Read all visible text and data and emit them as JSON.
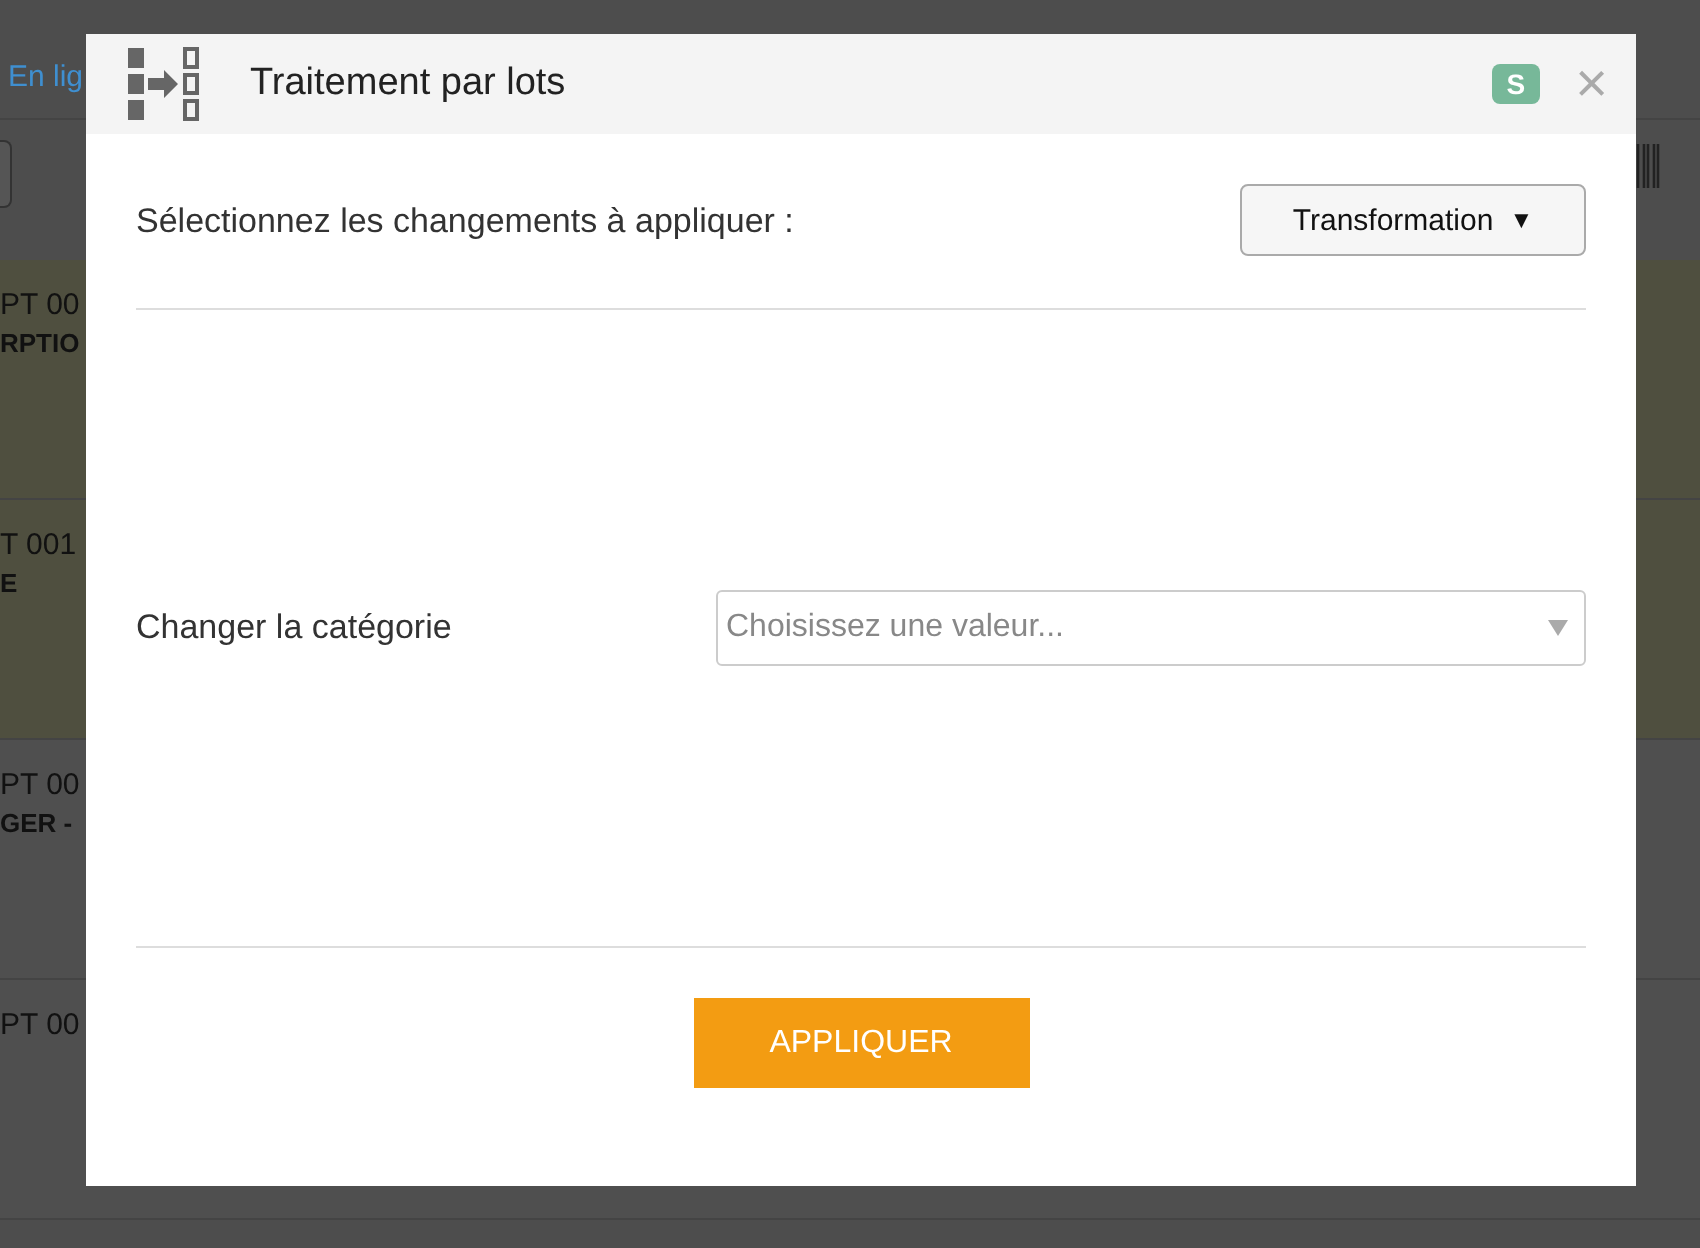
{
  "background": {
    "link": "En lig",
    "rows": [
      {
        "line_1": "PT 00",
        "line_2": "RPTIO",
        "highlighted": true
      },
      {
        "line_1": "T 001",
        "line_2": "E",
        "highlighted": true
      },
      {
        "line_1": "PT 00",
        "line_2": "GER -",
        "highlighted": false
      },
      {
        "line_1": "PT 00",
        "line_2": "",
        "highlighted": false
      }
    ]
  },
  "dialog": {
    "title": "Traitement par lots",
    "badge": "S",
    "close": "×",
    "prompt": "Sélectionnez les changements à appliquer :",
    "mode_button": "Transformation",
    "mode_caret": "▼",
    "field": {
      "label": "Changer la catégorie",
      "placeholder": "Choisissez une valeur..."
    },
    "apply_button": "APPLIQUER"
  }
}
